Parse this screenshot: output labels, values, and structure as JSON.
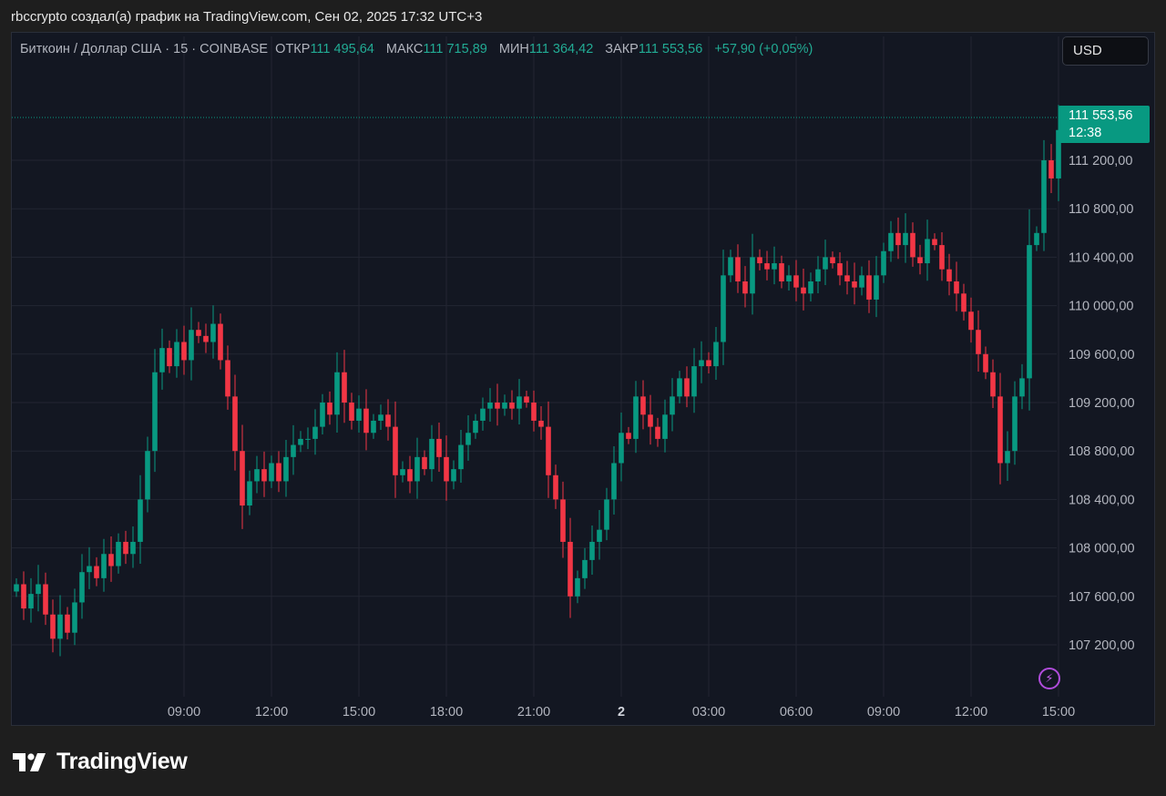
{
  "caption": "rbccrypto создал(а) график на TradingView.com, Сен 02, 2025 17:32 UTC+3",
  "legend": {
    "symbol": "Биткоин / Доллар США · 15 · COINBASE",
    "open_label": "ОТКР",
    "open": "111 495,64",
    "high_label": "МАКС",
    "high": "111 715,89",
    "low_label": "МИН",
    "low": "111 364,42",
    "close_label": "ЗАКР",
    "close": "111 553,56",
    "change": "+57,90 (+0,05%)"
  },
  "currency_button": "USD",
  "last_price": {
    "value": "111 553,56",
    "countdown": "12:38"
  },
  "brand": "TradingView",
  "colors": {
    "up": "#089981",
    "down": "#f23645",
    "background": "#131722",
    "grid": "#232632"
  },
  "chart_data": {
    "type": "candlestick",
    "y_ticks": [
      {
        "value": 107200,
        "label": "107 200,00"
      },
      {
        "value": 107600,
        "label": "107 600,00"
      },
      {
        "value": 108000,
        "label": "108 000,00"
      },
      {
        "value": 108400,
        "label": "108 400,00"
      },
      {
        "value": 108800,
        "label": "108 800,00"
      },
      {
        "value": 109200,
        "label": "109 200,00"
      },
      {
        "value": 109600,
        "label": "109 600,00"
      },
      {
        "value": 110000,
        "label": "110 000,00"
      },
      {
        "value": 110400,
        "label": "110 400,00"
      },
      {
        "value": 110800,
        "label": "110 800,00"
      },
      {
        "value": 111200,
        "label": "111 200,00"
      }
    ],
    "x_ticks": [
      {
        "index": 12,
        "label": "09:00"
      },
      {
        "index": 24,
        "label": "12:00"
      },
      {
        "index": 36,
        "label": "15:00"
      },
      {
        "index": 48,
        "label": "18:00"
      },
      {
        "index": 60,
        "label": "21:00"
      },
      {
        "index": 72,
        "label": "2",
        "bold": true
      },
      {
        "index": 84,
        "label": "03:00"
      },
      {
        "index": 96,
        "label": "06:00"
      },
      {
        "index": 108,
        "label": "09:00"
      },
      {
        "index": 120,
        "label": "12:00"
      },
      {
        "index": 132,
        "label": "15:00"
      }
    ],
    "last_price": 111553.56,
    "ylim": [
      106900,
      111800
    ],
    "bars": [
      107700,
      107500,
      107620,
      107700,
      107450,
      107250,
      107450,
      107300,
      107550,
      107800,
      107850,
      107750,
      107950,
      107850,
      108050,
      107950,
      108050,
      108400,
      108800,
      109450,
      109650,
      109500,
      109700,
      109550,
      109800,
      109750,
      109700,
      109850,
      109550,
      109250,
      108800,
      108350,
      108550,
      108650,
      108550,
      108700,
      108550,
      108750,
      108850,
      108900,
      108900,
      109000,
      109200,
      109100,
      109450,
      109200,
      109050,
      109150,
      108950,
      109050,
      109100,
      109000,
      108600,
      108650,
      108550,
      108750,
      108650,
      108900,
      108750,
      108550,
      108650,
      108850,
      108950,
      109050,
      109150,
      109200,
      109150,
      109200,
      109150,
      109250,
      109200,
      109050,
      109000,
      108600,
      108400,
      108050,
      107600,
      107750,
      107900,
      108050,
      108150,
      108400,
      108700,
      108950,
      108900,
      109250,
      109100,
      109000,
      108900,
      109100,
      109250,
      109400,
      109250,
      109500,
      109550,
      109500,
      109700,
      110250,
      110400,
      110200,
      110100,
      110400,
      110350,
      110300,
      110350,
      110200,
      110250,
      110150,
      110100,
      110200,
      110300,
      110400,
      110350,
      110250,
      110200,
      110150,
      110250,
      110050,
      110250,
      110450,
      110600,
      110500,
      110600,
      110400,
      110350,
      110550,
      110500,
      110300,
      110200,
      110100,
      109950,
      109800,
      109600,
      109450,
      109250,
      108700,
      108800,
      109250,
      109400,
      110500,
      110600,
      111200,
      111050,
      111450,
      111553.56
    ]
  }
}
